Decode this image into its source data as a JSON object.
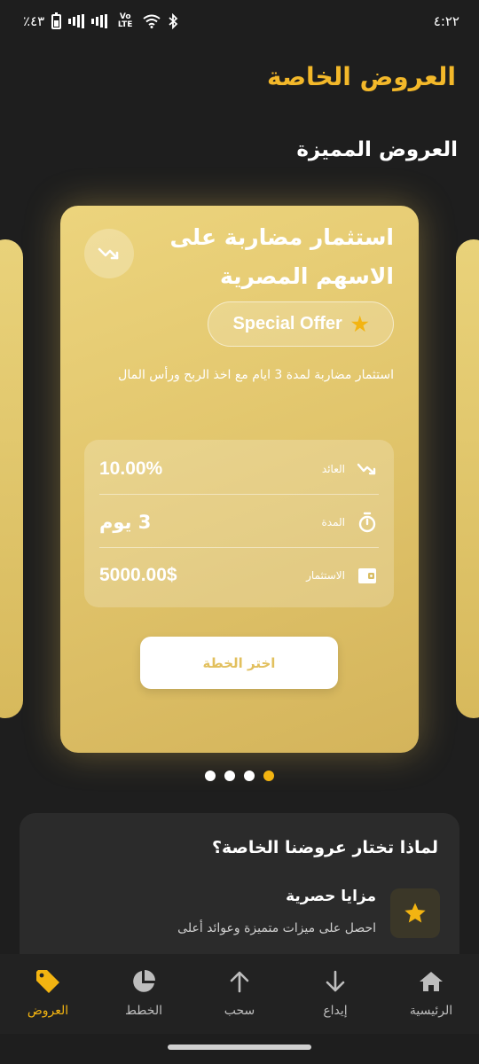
{
  "status_bar": {
    "time": "٤:٢٢",
    "battery": "٪٤٣",
    "network_badge": "Vo LTE",
    "icons": [
      "battery-icon",
      "signal-icon",
      "volte-icon",
      "wifi-icon",
      "bluetooth-icon"
    ]
  },
  "header": {
    "title": "العروض الخاصة"
  },
  "featured": {
    "section_title": "العروض المميزة",
    "active_slide": 4,
    "slide_count": 4,
    "card": {
      "title": "استثمار مضاربة على الاسهم المصرية",
      "badge_label": "Special Offer",
      "description": "استثمار مضاربة لمدة 3 ايام مع اخذ الربح ورأس المال",
      "rows": [
        {
          "label": "العائد",
          "value": "10.00%",
          "icon": "trend-icon"
        },
        {
          "label": "المدة",
          "value": "3 يوم",
          "icon": "timer-icon"
        },
        {
          "label": "الاستثمار",
          "value": "5000.00$",
          "icon": "wallet-icon"
        }
      ],
      "button_label": "اختر الخطة"
    }
  },
  "why": {
    "title": "لماذا تختار عروضنا الخاصة؟",
    "feature": {
      "title": "مزايا حصرية",
      "description": "احصل على ميزات متميزة وعوائد أعلى",
      "icon": "star-icon"
    }
  },
  "nav": {
    "items": [
      {
        "label": "الرئيسية",
        "icon": "home-icon",
        "active": false
      },
      {
        "label": "إيداع",
        "icon": "arrow-down-icon",
        "active": false
      },
      {
        "label": "سحب",
        "icon": "arrow-up-icon",
        "active": false
      },
      {
        "label": "الخطط",
        "icon": "pie-chart-icon",
        "active": false
      },
      {
        "label": "العروض",
        "icon": "tag-icon",
        "active": true
      }
    ]
  },
  "colors": {
    "accent": "#f3b411",
    "title_gold": "#f3b82a",
    "background": "#1e1e1e",
    "card_gold": "#e2c66d"
  }
}
